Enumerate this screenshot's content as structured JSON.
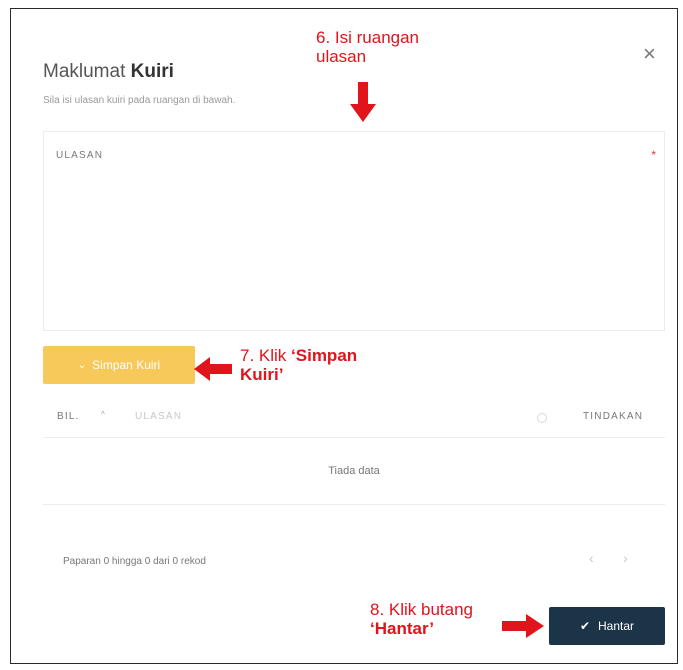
{
  "modal": {
    "title_prefix": "Maklumat ",
    "title_bold": "Kuiri",
    "subtitle": "Sila isi ulasan kuiri pada ruangan di bawah.",
    "close_glyph": "×"
  },
  "form": {
    "field_label": "ULASAN",
    "required_mark": "*"
  },
  "save_button": {
    "icon_glyph": "⌄",
    "label": "Simpan Kuiri"
  },
  "table": {
    "col_bil": "BIL.",
    "sort_glyph": "^",
    "col_ulasan": "ULASAN",
    "col_tindakan": "TINDAKAN",
    "empty_text": "Tiada data"
  },
  "pagination": {
    "summary": "Paparan 0 hingga 0 dari 0 rekod",
    "prev_glyph": "‹",
    "next_glyph": "›"
  },
  "submit_button": {
    "icon_glyph": "✔",
    "label": "Hantar"
  },
  "annotations": {
    "step6_line1": "6. Isi ruangan",
    "step6_line2": "ulasan",
    "step7_prefix": "7. Klik ",
    "step7_bold1": "‘Simpan",
    "step7_bold2": "Kuiri’",
    "step8_line1": "8. Klik butang",
    "step8_bold": "‘Hantar’",
    "color": "#e1131b"
  },
  "colors": {
    "save_button": "#f7c95a",
    "submit_button": "#1c3448"
  }
}
